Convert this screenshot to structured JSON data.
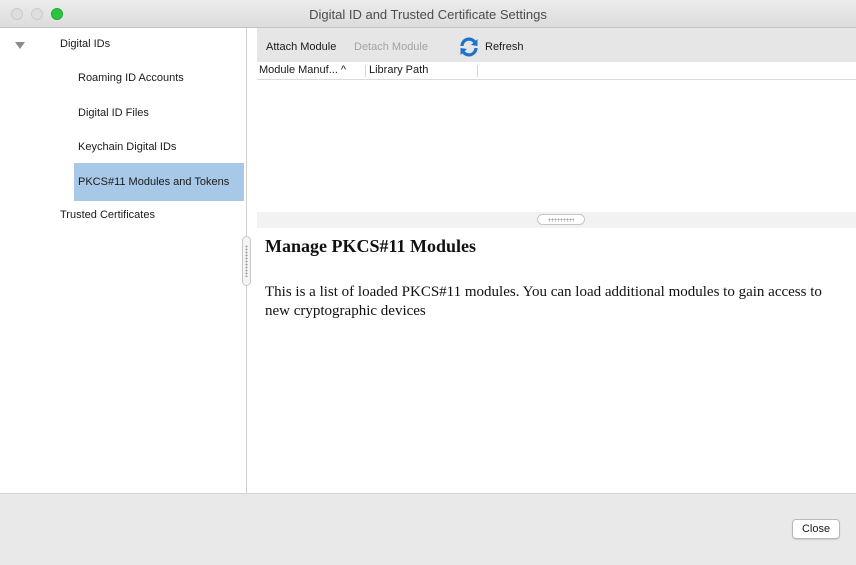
{
  "window": {
    "title": "Digital ID and Trusted Certificate Settings"
  },
  "sidebar": {
    "items": [
      {
        "label": "Digital IDs",
        "expanded": true
      },
      {
        "label": "Roaming ID Accounts"
      },
      {
        "label": "Digital ID Files"
      },
      {
        "label": "Keychain Digital IDs"
      },
      {
        "label": "PKCS#11 Modules and Tokens",
        "selected": true
      },
      {
        "label": "Trusted Certificates"
      }
    ]
  },
  "toolbar": {
    "attach_label": "Attach Module",
    "detach_label": "Detach Module",
    "refresh_label": "Refresh",
    "refresh_icon": "refresh-icon"
  },
  "table": {
    "columns": [
      "Module Manuf... ^",
      "Library Path"
    ],
    "rows": []
  },
  "description": {
    "title": "Manage PKCS#11 Modules",
    "body": "This is a list of loaded PKCS#11 modules. You can load additional modules to gain access to new cryptographic devices"
  },
  "footer": {
    "close_label": "Close"
  },
  "colors": {
    "selection": "#a8c8e8",
    "refresh_blue": "#1f74c9",
    "traffic_green": "#29c53f"
  }
}
